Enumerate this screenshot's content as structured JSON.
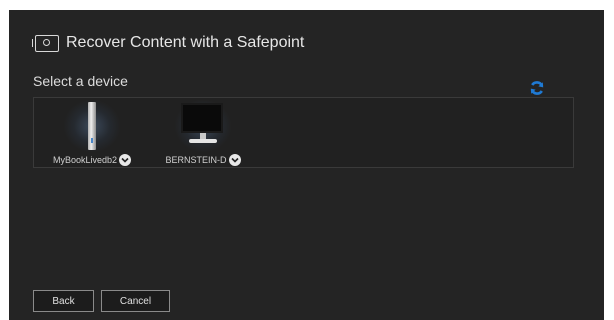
{
  "dialog": {
    "title": "Recover Content with a Safepoint",
    "title_icon": "safepoint-icon",
    "section_label": "Select a device",
    "refresh_icon": "refresh-icon",
    "accent_color": "#1f7ad4",
    "devices": [
      {
        "name": "MyBookLivedb2",
        "icon": "nas-drive-icon",
        "menu_icon": "chevron-down-icon"
      },
      {
        "name": "BERNSTEIN-D",
        "icon": "monitor-icon",
        "menu_icon": "chevron-down-icon"
      }
    ],
    "buttons": {
      "back_label": "Back",
      "cancel_label": "Cancel"
    }
  }
}
